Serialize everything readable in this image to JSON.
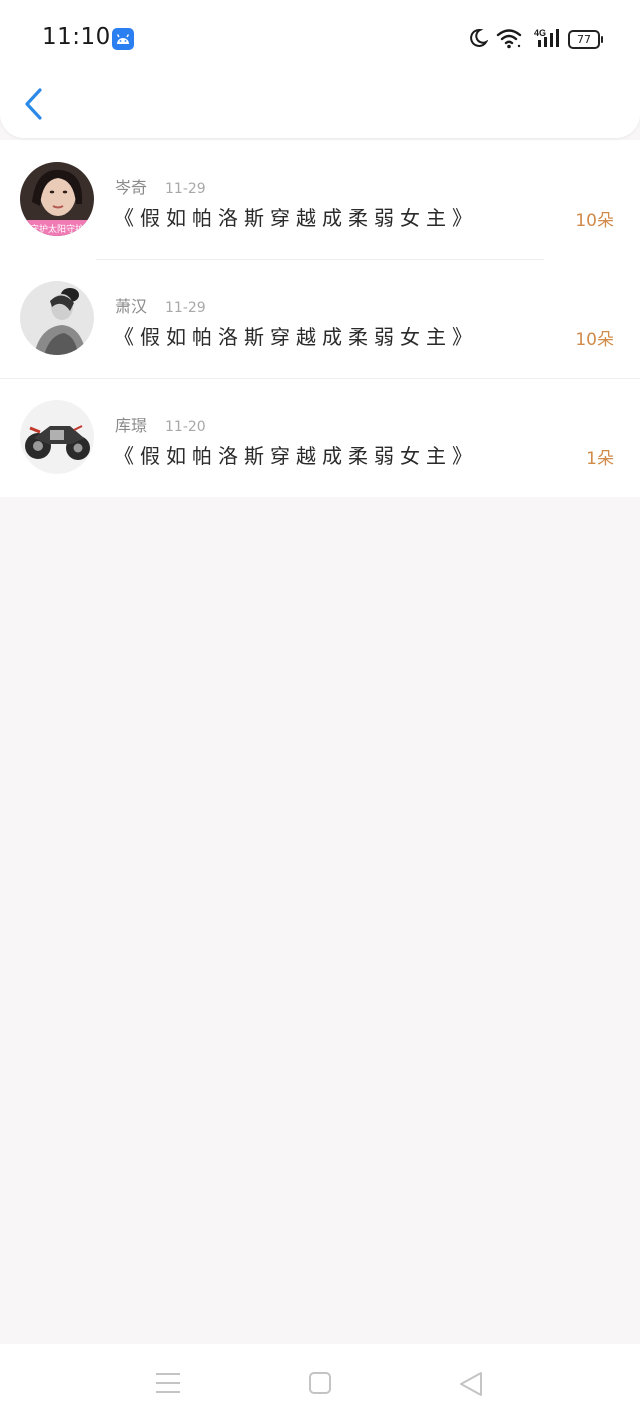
{
  "status_bar": {
    "time": "11:10",
    "network": "4G",
    "battery": "77"
  },
  "rows": [
    {
      "name": "岑奇",
      "date": "11-29",
      "title": "《假如帕洛斯穿越成柔弱女主》",
      "count": "10朵"
    },
    {
      "name": "萧汉",
      "date": "11-29",
      "title": "《假如帕洛斯穿越成柔弱女主》",
      "count": "10朵"
    },
    {
      "name": "库璟",
      "date": "11-20",
      "title": "《假如帕洛斯穿越成柔弱女主》",
      "count": "1朵"
    }
  ],
  "avatar_text": "守护太阳守护",
  "colors": {
    "accent": "#2b8ae8",
    "count": "#d08a4a",
    "background": "#f8f6f7"
  },
  "icons": {
    "back": "chevron-left-icon",
    "menu": "menu-icon",
    "home": "home-square-icon",
    "nav_back": "triangle-back-icon"
  }
}
